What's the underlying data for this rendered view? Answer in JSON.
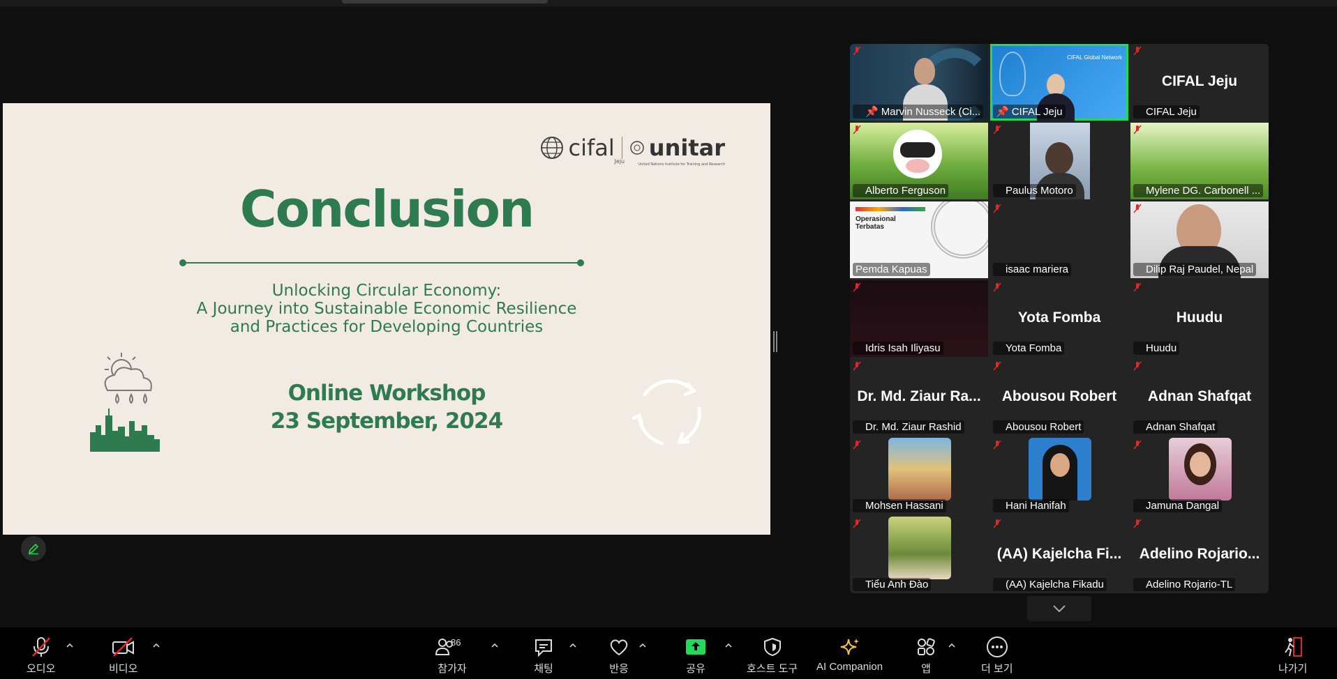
{
  "slide": {
    "logo_text": "cifal",
    "logo_sub": "Jeju",
    "logo_unitar": "unitar",
    "logo_unitar_sub": "United Nations Institute for Training and Research",
    "title": "Conclusion",
    "subtitle_lines": [
      "Unlocking Circular Economy:",
      "A Journey into Sustainable Economic Resilience",
      "and Practices for Developing Countries"
    ],
    "workshop": "Online Workshop",
    "date": "23 September, 2024"
  },
  "participants": [
    {
      "name": "Marvin Nusseck (Ci...",
      "big": "",
      "video": "person",
      "pinned": true,
      "muted": true
    },
    {
      "name": "CIFAL Jeju",
      "big": "",
      "video": "cifal",
      "pinned": true,
      "muted": false,
      "active": true
    },
    {
      "name": "CIFAL Jeju",
      "big": "CIFAL Jeju",
      "video": "none",
      "muted": true
    },
    {
      "name": "Alberto Ferguson",
      "big": "",
      "video": "grass",
      "muted": true
    },
    {
      "name": "Paulus Motoro",
      "big": "",
      "video": "face",
      "muted": true
    },
    {
      "name": "Mylene DG. Carbonell ...",
      "big": "",
      "video": "grass2",
      "muted": true
    },
    {
      "name": "Pemda Kapuas",
      "big": "",
      "video": "doc",
      "muted": false
    },
    {
      "name": "isaac mariera",
      "big": "",
      "video": "none",
      "muted": true
    },
    {
      "name": "Dilip Raj Paudel, Nepal",
      "big": "",
      "video": "suit",
      "muted": true
    },
    {
      "name": "Idris Isah Iliyasu",
      "big": "",
      "video": "dark",
      "muted": true
    },
    {
      "name": "Yota Fomba",
      "big": "Yota Fomba",
      "video": "none",
      "muted": true
    },
    {
      "name": "Huudu",
      "big": "Huudu",
      "video": "none",
      "muted": true
    },
    {
      "name": "Dr. Md. Ziaur Rashid",
      "big": "Dr. Md. Ziaur Ra...",
      "video": "none",
      "muted": true
    },
    {
      "name": "Abousou Robert",
      "big": "Abousou Robert",
      "video": "none",
      "muted": true
    },
    {
      "name": "Adnan Shafqat",
      "big": "Adnan Shafqat",
      "video": "none",
      "muted": true
    },
    {
      "name": "Mohsen Hassani",
      "big": "",
      "video": "avatar-street",
      "muted": true
    },
    {
      "name": "Hani Hanifah",
      "big": "",
      "video": "avatar-hijab",
      "muted": true
    },
    {
      "name": "Jamuna Dangal",
      "big": "",
      "video": "avatar-girl",
      "muted": true
    },
    {
      "name": "Tiểu Anh Đào",
      "big": "",
      "video": "avatar-outdoor",
      "muted": true
    },
    {
      "name": "(AA) Kajelcha Fikadu",
      "big": "(AA)  Kajelcha  Fi...",
      "video": "none",
      "muted": true
    },
    {
      "name": "Adelino Rojario-TL",
      "big": "Adelino  Rojario...",
      "video": "none",
      "muted": true
    }
  ],
  "toolbar": {
    "audio": "오디오",
    "video": "비디오",
    "participants": "참가자",
    "participants_count": "86",
    "chat": "채팅",
    "react": "반응",
    "share": "공유",
    "host_tools": "호스트 도구",
    "ai_companion": "AI Companion",
    "apps": "앱",
    "more": "더 보기",
    "leave": "나가기"
  },
  "colors": {
    "accent_green": "#23d959",
    "slide_green": "#2e7b4f",
    "mute_red": "#e02828"
  }
}
